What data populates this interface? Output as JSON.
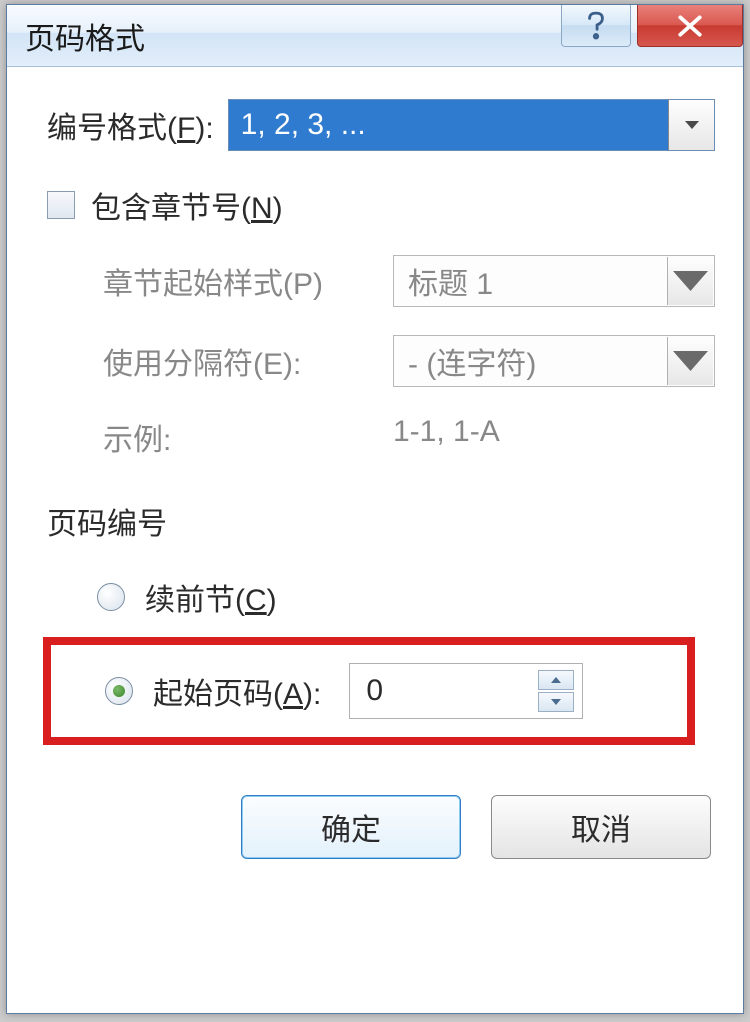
{
  "title": "页码格式",
  "numberFormat": {
    "label_pre": "编号格式(",
    "label_key": "F",
    "label_post": "):",
    "value": "1, 2, 3, ..."
  },
  "includeChapter": {
    "label_pre": "包含章节号(",
    "label_key": "N",
    "label_post": ")",
    "checked": false
  },
  "chapterStart": {
    "label": "章节起始样式(P)",
    "value": "标题 1"
  },
  "separator": {
    "label": "使用分隔符(E):",
    "value": "-   (连字符)"
  },
  "example": {
    "label": "示例:",
    "value": "1-1, 1-A"
  },
  "pageNumbering": {
    "groupLabel": "页码编号",
    "continue": {
      "label_pre": "续前节(",
      "label_key": "C",
      "label_post": ")",
      "checked": false
    },
    "startAt": {
      "label_pre": "起始页码(",
      "label_key": "A",
      "label_post": "):",
      "checked": true,
      "value": "0"
    }
  },
  "buttons": {
    "ok": "确定",
    "cancel": "取消"
  }
}
